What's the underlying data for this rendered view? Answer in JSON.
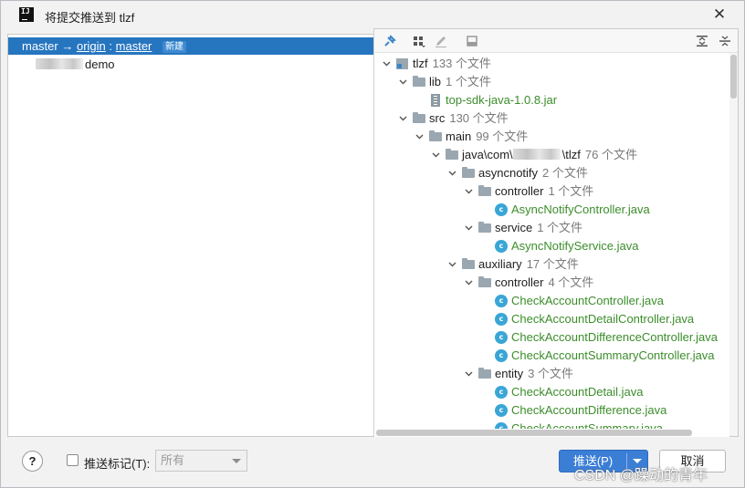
{
  "window": {
    "title": "将提交推送到 tlzf",
    "app_icon_text": "IJ"
  },
  "left_pane": {
    "branch": {
      "local": "master",
      "arrow": "→",
      "remote": "origin",
      "separator": ":",
      "remote_branch": "master",
      "badge": "新建"
    },
    "repo_name": "demo"
  },
  "toolbar": {
    "icons": [
      "pin-icon",
      "group-by-icon",
      "edit-icon",
      "diff-icon",
      "expand-all-icon",
      "collapse-all-icon"
    ]
  },
  "tree": [
    {
      "level": 0,
      "type": "project",
      "name": "tlzf",
      "count": "133 个文件",
      "expanded": true
    },
    {
      "level": 1,
      "type": "folder",
      "name": "lib",
      "count": "1 个文件",
      "expanded": true
    },
    {
      "level": 2,
      "type": "jar",
      "name": "top-sdk-java-1.0.8.jar",
      "count": "",
      "green": true
    },
    {
      "level": 1,
      "type": "folder",
      "name": "src",
      "count": "130 个文件",
      "expanded": true
    },
    {
      "level": 2,
      "type": "folder",
      "name": "main",
      "count": "99 个文件",
      "expanded": true
    },
    {
      "level": 3,
      "type": "folder",
      "name": "java\\com\\",
      "suffix": "\\tlzf",
      "count": "76 个文件",
      "expanded": true,
      "blurred": true
    },
    {
      "level": 4,
      "type": "folder",
      "name": "asyncnotify",
      "count": "2 个文件",
      "expanded": true
    },
    {
      "level": 5,
      "type": "folder",
      "name": "controller",
      "count": "1 个文件",
      "expanded": true
    },
    {
      "level": 6,
      "type": "class",
      "name": "AsyncNotifyController.java",
      "count": "",
      "green": true
    },
    {
      "level": 5,
      "type": "folder",
      "name": "service",
      "count": "1 个文件",
      "expanded": true
    },
    {
      "level": 6,
      "type": "class",
      "name": "AsyncNotifyService.java",
      "count": "",
      "green": true
    },
    {
      "level": 4,
      "type": "folder",
      "name": "auxiliary",
      "count": "17 个文件",
      "expanded": true
    },
    {
      "level": 5,
      "type": "folder",
      "name": "controller",
      "count": "4 个文件",
      "expanded": true
    },
    {
      "level": 6,
      "type": "class",
      "name": "CheckAccountController.java",
      "count": "",
      "green": true
    },
    {
      "level": 6,
      "type": "class",
      "name": "CheckAccountDetailController.java",
      "count": "",
      "green": true
    },
    {
      "level": 6,
      "type": "class",
      "name": "CheckAccountDifferenceController.java",
      "count": "",
      "green": true
    },
    {
      "level": 6,
      "type": "class",
      "name": "CheckAccountSummaryController.java",
      "count": "",
      "green": true
    },
    {
      "level": 5,
      "type": "folder",
      "name": "entity",
      "count": "3 个文件",
      "expanded": true
    },
    {
      "level": 6,
      "type": "class",
      "name": "CheckAccountDetail.java",
      "count": "",
      "green": true
    },
    {
      "level": 6,
      "type": "class",
      "name": "CheckAccountDifference.java",
      "count": "",
      "green": true
    },
    {
      "level": 6,
      "type": "class",
      "name": "CheckAccountSummary.java",
      "count": "",
      "green": true
    }
  ],
  "footer": {
    "help": "?",
    "push_tags_label": "推送标记(T):",
    "tags_select_value": "所有",
    "push_button": "推送(P)",
    "cancel_button": "取消",
    "watermark": "CSDN @躁动的青年"
  },
  "colors": {
    "selection": "#2675bf",
    "new_file_green": "#3b8d2b",
    "primary_button": "#3b7ed6"
  }
}
